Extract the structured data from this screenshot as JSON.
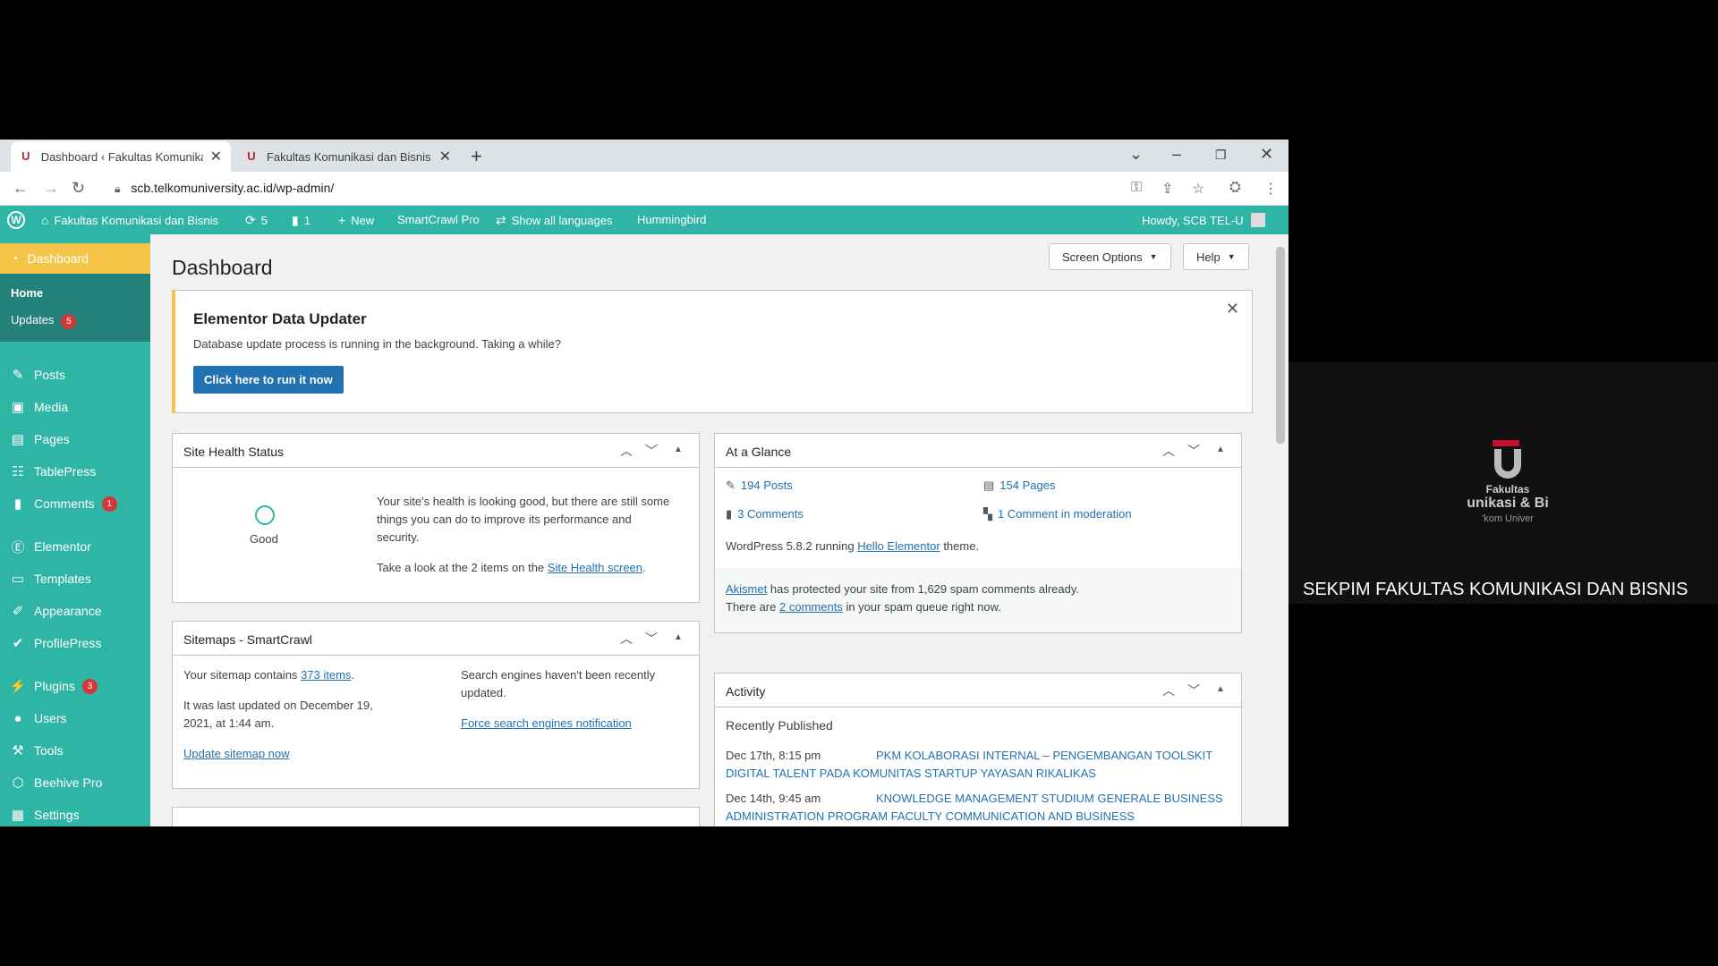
{
  "tabs": [
    {
      "title": "Dashboard ‹ Fakultas Komunikasi"
    },
    {
      "title": "Fakultas Komunikasi dan Bisnis |"
    }
  ],
  "address": {
    "url": "scb.telkomuniversity.ac.id/wp-admin/"
  },
  "adminbar": {
    "site": "Fakultas Komunikasi dan Bisnis",
    "updates": "5",
    "comments": "1",
    "new": "New",
    "smartcrawl": "SmartCrawl Pro",
    "languages": "Show all languages",
    "hummingbird": "Hummingbird",
    "howdy": "Howdy, SCB TEL-U"
  },
  "sidebar": {
    "dashboard": "Dashboard",
    "home": "Home",
    "updates": "Updates",
    "updates_count": "5",
    "items": [
      {
        "label": "Posts",
        "icon": "pin-icon"
      },
      {
        "label": "Media",
        "icon": "media-icon"
      },
      {
        "label": "Pages",
        "icon": "page-icon"
      },
      {
        "label": "TablePress",
        "icon": "table-icon"
      },
      {
        "label": "Comments",
        "icon": "comment-icon",
        "badge": "1"
      },
      {
        "label": "Elementor",
        "icon": "elementor-icon"
      },
      {
        "label": "Templates",
        "icon": "folder-icon"
      },
      {
        "label": "Appearance",
        "icon": "brush-icon"
      },
      {
        "label": "ProfilePress",
        "icon": "profile-icon"
      },
      {
        "label": "Plugins",
        "icon": "plugin-icon",
        "badge": "3"
      },
      {
        "label": "Users",
        "icon": "user-icon"
      },
      {
        "label": "Tools",
        "icon": "wrench-icon"
      },
      {
        "label": "Beehive Pro",
        "icon": "hive-icon"
      },
      {
        "label": "Settings",
        "icon": "settings-icon"
      }
    ]
  },
  "page": {
    "title": "Dashboard",
    "screen_options": "Screen Options",
    "help": "Help"
  },
  "notice": {
    "title": "Elementor Data Updater",
    "text": "Database update process is running in the background. Taking a while?",
    "button": "Click here to run it now"
  },
  "site_health": {
    "title": "Site Health Status",
    "status": "Good",
    "line1": "Your site's health is looking good, but there are still some",
    "line2": "things you can do to improve its performance and",
    "line3": "security.",
    "look_pre": "Take a look at the 2 items on the",
    "look_link": "Site Health screen",
    "look_post": "."
  },
  "sitemaps": {
    "title": "Sitemaps - SmartCrawl",
    "contains_pre": "Your sitemap contains",
    "contains_link": "373 items",
    "contains_post": ".",
    "updated1": "It was last updated on December 19,",
    "updated2": "2021, at 1:44 am.",
    "update_link": "Update sitemap now",
    "engines1": "Search engines haven't been recently",
    "engines2": "updated.",
    "force_link": "Force search engines notification"
  },
  "glance": {
    "title": "At a Glance",
    "posts": "194 Posts",
    "pages": "154 Pages",
    "comments": "3 Comments",
    "moderation": "1 Comment in moderation",
    "wp_pre": "WordPress 5.8.2 running",
    "wp_theme": "Hello Elementor",
    "wp_post": "theme.",
    "akismet_link": "Akismet",
    "akismet_text": "has protected your site from 1,629 spam comments already.",
    "spam_pre": "There are",
    "spam_link": "2 comments",
    "spam_post": "in your spam queue right now."
  },
  "activity": {
    "title": "Activity",
    "recent": "Recently Published",
    "entries": [
      {
        "date": "Dec 17th, 8:15 pm",
        "title1": "PKM KOLABORASI INTERNAL – PENGEMBANGAN TOOLSKIT",
        "title2": "DIGITAL TALENT PADA KOMUNITAS STARTUP YAYASAN RIKALIKAS"
      },
      {
        "date": "Dec 14th, 9:45 am",
        "title1": "KNOWLEDGE MANAGEMENT STUDIUM GENERALE BUSINESS",
        "title2": "ADMINISTRATION PROGRAM FACULTY COMMUNICATION AND BUSINESS"
      }
    ]
  },
  "video": {
    "caption": "SEKPIM FAKULTAS KOMUNIKASI DAN BISNIS",
    "logo_line1": "Fakultas",
    "logo_line2": "unikasi & Bi",
    "logo_line3": "'kom Univer"
  },
  "colors": {
    "accent": "#2fb5a5",
    "highlight": "#f5c54a",
    "link": "#2271b1"
  }
}
